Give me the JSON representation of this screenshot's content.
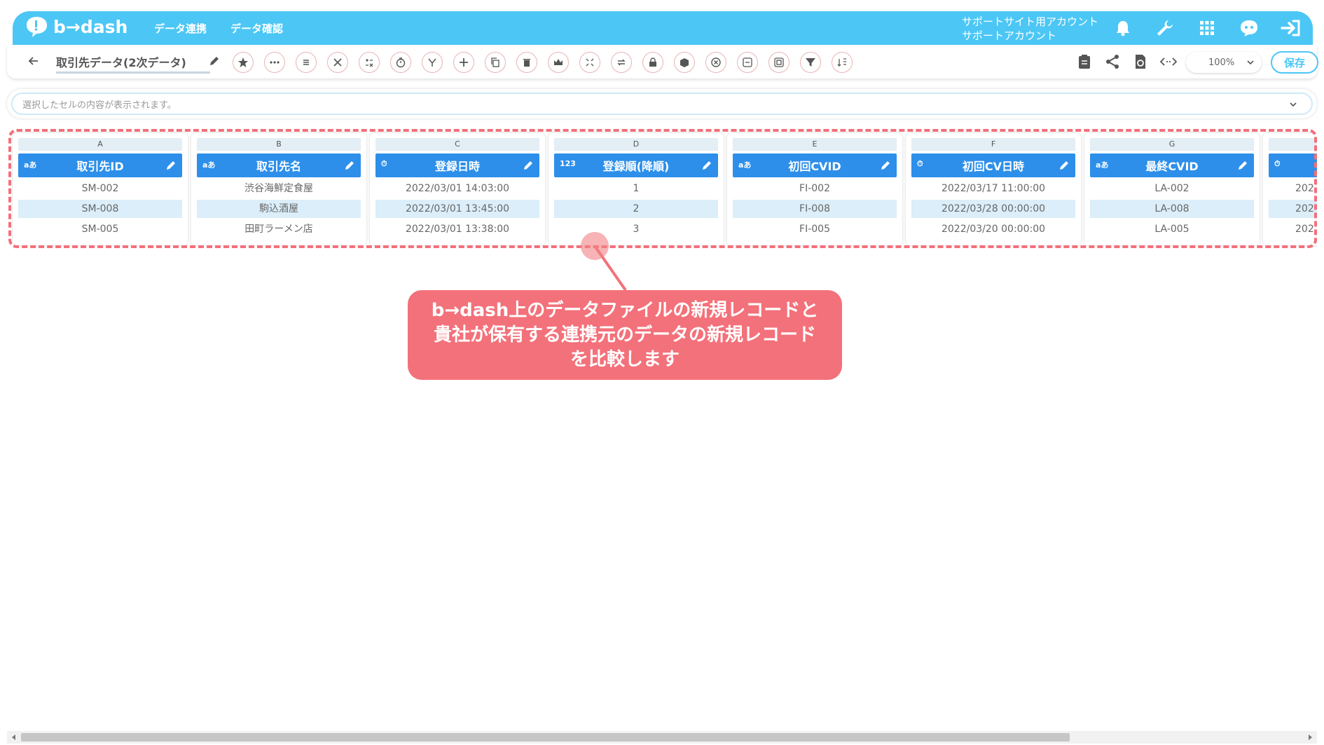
{
  "colors": {
    "brand": "#4cc7f5",
    "column_header": "#2d8fea",
    "stripe": "#dbeef9",
    "callout": "#f3717a"
  },
  "header": {
    "logo": "b→dash",
    "nav": [
      "データ連携",
      "データ確認"
    ],
    "account_line1": "サポートサイト用アカウント",
    "account_line2": "サポートアカウント",
    "icons": [
      "bell-icon",
      "wrench-icon",
      "grid-icon",
      "chat-bot-icon",
      "logout-icon"
    ]
  },
  "toolbar": {
    "title": "取引先データ(2次データ)",
    "zoom": "100%",
    "save_label": "保存"
  },
  "cellbar": {
    "placeholder": "選択したセルの内容が表示されます。"
  },
  "columns": [
    {
      "letter": "A",
      "name": "取引先ID",
      "type": "aあ",
      "cells": [
        "SM-002",
        "SM-008",
        "SM-005"
      ]
    },
    {
      "letter": "B",
      "name": "取引先名",
      "type": "aあ",
      "cells": [
        "渋谷海鮮定食屋",
        "駒込酒屋",
        "田町ラーメン店"
      ]
    },
    {
      "letter": "C",
      "name": "登録日時",
      "type": "⏱",
      "cells": [
        "2022/03/01 14:03:00",
        "2022/03/01 13:45:00",
        "2022/03/01 13:38:00"
      ]
    },
    {
      "letter": "D",
      "name": "登録順(降順)",
      "type": "123",
      "cells": [
        "1",
        "2",
        "3"
      ]
    },
    {
      "letter": "E",
      "name": "初回CVID",
      "type": "aあ",
      "cells": [
        "FI-002",
        "FI-008",
        "FI-005"
      ]
    },
    {
      "letter": "F",
      "name": "初回CV日時",
      "type": "⏱",
      "cells": [
        "2022/03/17 11:00:00",
        "2022/03/28 00:00:00",
        "2022/03/20 00:00:00"
      ]
    },
    {
      "letter": "G",
      "name": "最終CVID",
      "type": "aあ",
      "cells": [
        "LA-002",
        "LA-008",
        "LA-005"
      ]
    },
    {
      "letter": "",
      "name": "",
      "type": "⏱",
      "cells": [
        "202",
        "202",
        "202"
      ]
    }
  ],
  "callout": {
    "line1": "b→dash上のデータファイルの新規レコードと",
    "line2": "貴社が保有する連携元のデータの新規レコード",
    "line3": "を比較します"
  }
}
